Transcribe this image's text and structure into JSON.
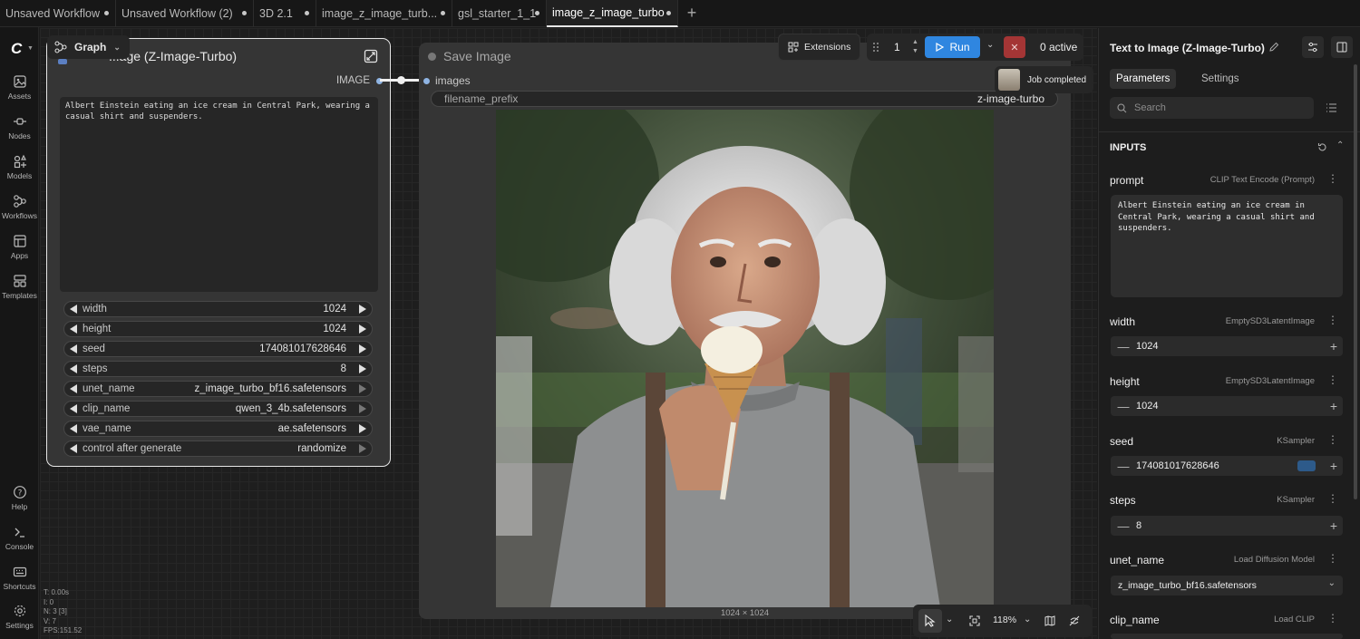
{
  "tabs": [
    {
      "label": "Unsaved Workflow"
    },
    {
      "label": "Unsaved Workflow (2)"
    },
    {
      "label": "3D 2.1"
    },
    {
      "label": "image_z_image_turb..."
    },
    {
      "label": "gsl_starter_1_1"
    },
    {
      "label": "image_z_image_turbo"
    }
  ],
  "rail": {
    "items": [
      {
        "label": "Assets",
        "icon": "image-icon"
      },
      {
        "label": "Nodes",
        "icon": "nodes-icon"
      },
      {
        "label": "Models",
        "icon": "models-icon"
      },
      {
        "label": "Workflows",
        "icon": "workflows-icon"
      },
      {
        "label": "Apps",
        "icon": "apps-icon"
      },
      {
        "label": "Templates",
        "icon": "templates-icon"
      },
      {
        "label": "Help",
        "icon": "help-icon"
      },
      {
        "label": "Console",
        "icon": "console-icon"
      },
      {
        "label": "Shortcuts",
        "icon": "keyboard-icon"
      },
      {
        "label": "Settings",
        "icon": "gear-icon"
      }
    ]
  },
  "graph_menu": {
    "label": "Graph"
  },
  "node_t2i": {
    "title": "...age (Z-Image-Turbo)",
    "output_label": "IMAGE",
    "prompt": "Albert Einstein eating an ice cream in Central Park, wearing a casual shirt and suspenders.",
    "widgets": [
      {
        "name": "width",
        "value": "1024"
      },
      {
        "name": "height",
        "value": "1024"
      },
      {
        "name": "seed",
        "value": "174081017628646"
      },
      {
        "name": "steps",
        "value": "8"
      },
      {
        "name": "unet_name",
        "value": "z_image_turbo_bf16.safetensors"
      },
      {
        "name": "clip_name",
        "value": "qwen_3_4b.safetensors"
      },
      {
        "name": "vae_name",
        "value": "ae.safetensors"
      },
      {
        "name": "control after generate",
        "value": "randomize"
      }
    ]
  },
  "node_save": {
    "title": "Save Image",
    "input_label": "images",
    "filename_label": "filename_prefix",
    "filename_value": "z-image-turbo",
    "dimensions": "1024 × 1024"
  },
  "toolbar": {
    "extensions": "Extensions",
    "queue_count": "1",
    "run": "Run",
    "active": "0 active",
    "toast": "Job completed"
  },
  "stats": [
    "T: 0.00s",
    "I: 0",
    "N: 3 [3]",
    "V: 7",
    "FPS:151.52"
  ],
  "zoom": "118%",
  "panel": {
    "title": "Text to Image (Z-Image-Turbo)",
    "tabs": [
      "Parameters",
      "Settings"
    ],
    "search_placeholder": "Search",
    "section": "INPUTS",
    "prompt": {
      "label": "prompt",
      "source": "CLIP Text Encode (Prompt)",
      "value": "Albert Einstein eating an ice cream in Central Park, wearing a casual shirt and suspenders."
    },
    "width": {
      "label": "width",
      "source": "EmptySD3LatentImage",
      "value": "1024"
    },
    "height": {
      "label": "height",
      "source": "EmptySD3LatentImage",
      "value": "1024"
    },
    "seed": {
      "label": "seed",
      "source": "KSampler",
      "value": "174081017628646"
    },
    "steps": {
      "label": "steps",
      "source": "KSampler",
      "value": "8"
    },
    "unet": {
      "label": "unet_name",
      "source": "Load Diffusion Model",
      "value": "z_image_turbo_bf16.safetensors"
    },
    "clip": {
      "label": "clip_name",
      "source": "Load CLIP"
    }
  },
  "colors": {
    "accent": "#2f86e0",
    "cancel": "#a43535",
    "link": "#8fb4e3"
  }
}
